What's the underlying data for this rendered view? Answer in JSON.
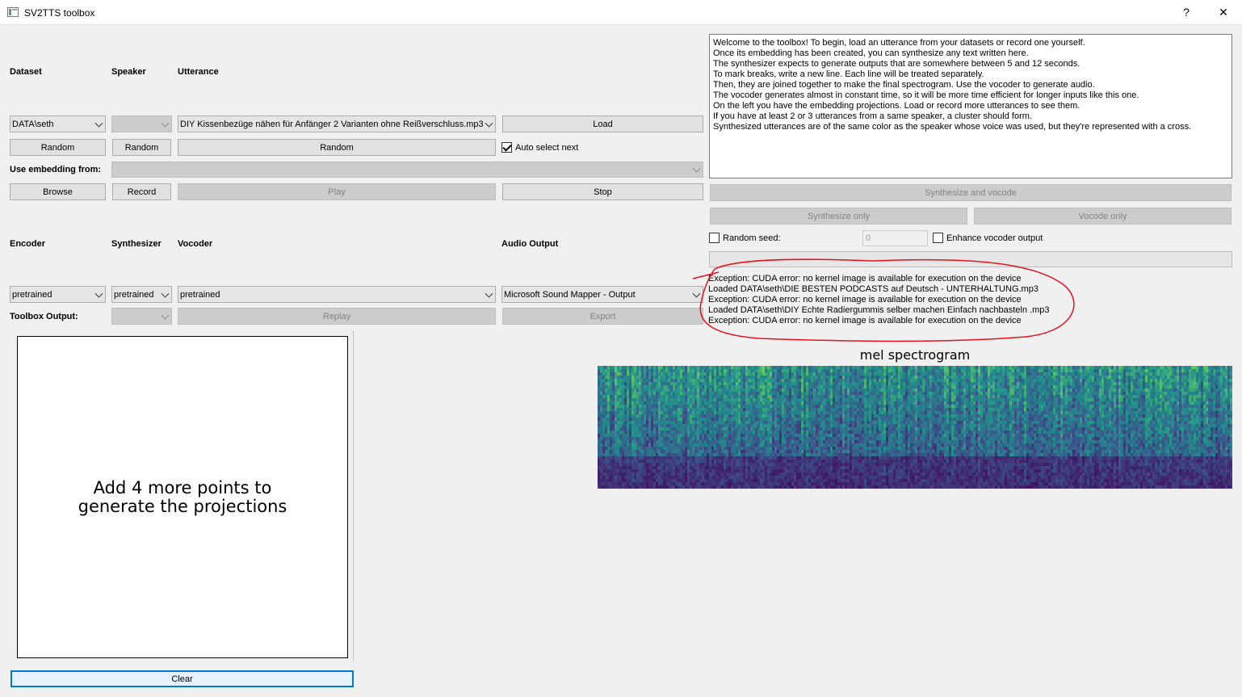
{
  "window": {
    "title": "SV2TTS toolbox",
    "help": "?",
    "close": "✕"
  },
  "labels": {
    "dataset": "Dataset",
    "speaker": "Speaker",
    "utterance": "Utterance",
    "use_embedding": "Use embedding from:",
    "encoder": "Encoder",
    "synthesizer": "Synthesizer",
    "vocoder": "Vocoder",
    "audio_output": "Audio Output",
    "toolbox_output": "Toolbox Output:"
  },
  "dataset_select": "DATA\\seth",
  "speaker_select": "",
  "utterance_select": "DIY Kissenbezüge nähen für Anfänger  2 Varianten ohne Reißverschluss.mp3",
  "buttons": {
    "load": "Load",
    "random_dataset": "Random",
    "random_speaker": "Random",
    "random_utterance": "Random",
    "browse": "Browse",
    "record": "Record",
    "play": "Play",
    "stop": "Stop",
    "synth_vocode": "Synthesize and vocode",
    "synth_only": "Synthesize only",
    "vocode_only": "Vocode only",
    "replay": "Replay",
    "export": "Export",
    "clear": "Clear"
  },
  "auto_select_next": "Auto select next",
  "encoder_select": "pretrained",
  "synthesizer_select": "pretrained",
  "vocoder_select": "pretrained",
  "audio_output_select": "Microsoft Sound Mapper - Output",
  "random_seed_label": "Random seed:",
  "seed_value": "0",
  "enhance_label": "Enhance vocoder output",
  "instructions": [
    "Welcome to the toolbox! To begin, load an utterance from your datasets or record one yourself.",
    "Once its embedding has been created, you can synthesize any text written here.",
    "The synthesizer expects to generate outputs that are somewhere between 5 and 12 seconds.",
    "To mark breaks, write a new line. Each line will be treated separately.",
    "Then, they are joined together to make the final spectrogram. Use the vocoder to generate audio.",
    "The vocoder generates almost in constant time, so it will be more time efficient for longer inputs like this one.",
    "On the left you have the embedding projections. Load or record more utterances to see them.",
    "If you have at least 2 or 3 utterances from a same speaker, a cluster should form.",
    "Synthesized utterances are of the same color as the speaker whose voice was used, but they're represented with a cross."
  ],
  "log": [
    "Exception: CUDA error: no kernel image is available for execution on the device",
    "Loaded DATA\\seth\\DIE BESTEN PODCASTS auf Deutsch - UNTERHALTUNG.mp3",
    "Exception: CUDA error: no kernel image is available for execution on the device",
    "Loaded DATA\\seth\\DIY Echte Radiergummis selber machen Einfach nachbasteln .mp3",
    "Exception: CUDA error: no kernel image is available for execution on the device"
  ],
  "projection_msg": "Add 4 more points to generate the projections",
  "spectrogram_title": "mel spectrogram",
  "colors": {
    "annotation": "#e8111b",
    "button": "#e1e1e1",
    "button_disabled": "#cccccc",
    "clear_border": "#0078d7"
  }
}
